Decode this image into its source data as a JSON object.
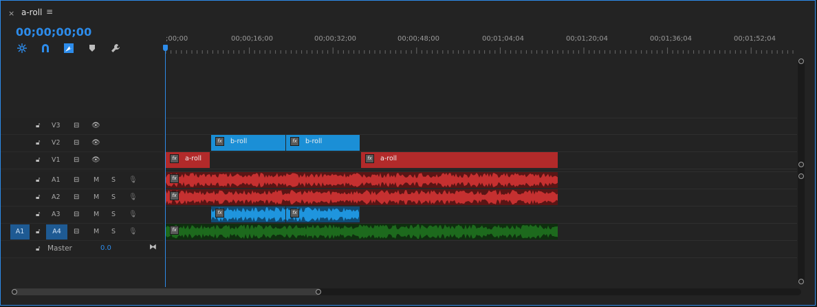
{
  "tab": {
    "close_glyph": "×",
    "title": "a-roll",
    "menu_glyph": "≡"
  },
  "timecode": "00;00;00;00",
  "tools": [
    "snap-icon",
    "magnet-icon",
    "linked-selection-icon",
    "marker-icon",
    "wrench-icon"
  ],
  "ruler": {
    "labels": [
      ";00;00",
      "00;00;16;00",
      "00;00;32;00",
      "00;00;48;00",
      "00;01;04;04",
      "00;01;20;04",
      "00;01;36;04",
      "00;01;52;04"
    ]
  },
  "tracks": {
    "v3": {
      "name": "V3"
    },
    "v2": {
      "name": "V2"
    },
    "v1": {
      "name": "V1"
    },
    "a1": {
      "name": "A1",
      "mute": "M",
      "solo": "S"
    },
    "a2": {
      "name": "A2",
      "mute": "M",
      "solo": "S"
    },
    "a3": {
      "name": "A3",
      "mute": "M",
      "solo": "S"
    },
    "a4": {
      "name": "A4",
      "source_patch": "A1",
      "mute": "M",
      "solo": "S"
    },
    "master": {
      "name": "Master",
      "level": "0.0"
    }
  },
  "clips": {
    "v2_1": {
      "label": "b-roll"
    },
    "v2_2": {
      "label": "b-roll"
    },
    "v1_1": {
      "label": "a-roll"
    },
    "v1_2": {
      "label": "a-roll"
    }
  },
  "colors": {
    "accent": "#2d8ceb",
    "video_aroll": "#b22a2a",
    "video_broll": "#1b8fd6",
    "audio_aroll": "#a32626",
    "audio_broll": "#1f86c8",
    "audio_green": "#1c5a1c"
  }
}
